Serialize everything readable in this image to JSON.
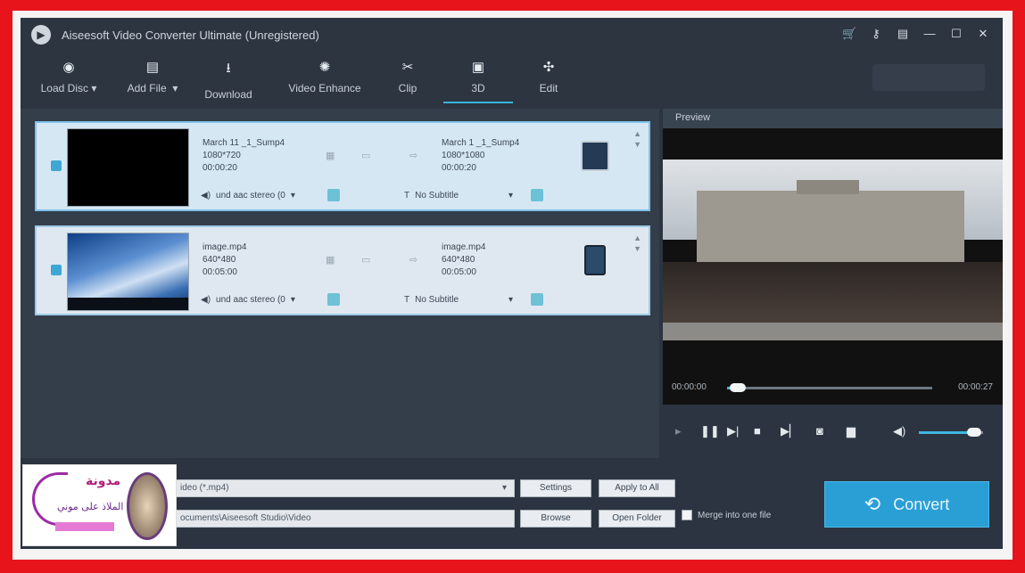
{
  "app": {
    "title": "Aiseesoft Video Converter Ultimate (Unregistered)"
  },
  "window_controls": [
    "cart-icon",
    "key-icon",
    "feedback-icon",
    "minimize-icon",
    "maximize-icon",
    "close-icon"
  ],
  "toolbar": {
    "items": [
      {
        "label": "Load Disc",
        "icon": "disc-icon"
      },
      {
        "label": "Add File",
        "icon": "add-file-icon"
      },
      {
        "label": "Download",
        "icon": "download-icon"
      },
      {
        "label": "Video Enhance",
        "icon": "enhance-icon"
      },
      {
        "label": "Clip",
        "icon": "scissors-icon"
      },
      {
        "label": "3D",
        "icon": "3d-icon"
      },
      {
        "label": "Edit",
        "icon": "edit-icon"
      }
    ]
  },
  "files": [
    {
      "source_name": "March 11 _1_Sump4",
      "source_res": "1080*720",
      "source_duration": "00:00:20",
      "target_name": "March 1 _1_Sump4",
      "target_res": "1080*1080",
      "target_duration": "00:00:20",
      "audio": "und aac stereo (0",
      "subtitle": "No Subtitle",
      "device_icon": "video-file-icon"
    },
    {
      "source_name": "image.mp4",
      "source_res": "640*480",
      "source_duration": "00:05:00",
      "target_name": "image.mp4",
      "target_res": "640*480",
      "target_duration": "00:05:00",
      "audio": "und aac stereo (0",
      "subtitle": "No Subtitle",
      "device_icon": "tablet-icon"
    }
  ],
  "preview": {
    "label": "Preview",
    "time_current": "00:00:00",
    "time_total": "00:00:27",
    "progress_fraction": 0.03,
    "volume_fraction": 0.8
  },
  "bottom": {
    "profile_value": "ideo (*.mp4)",
    "settings_label": "Settings",
    "apply_all_label": "Apply to All",
    "destination_value": "ocuments\\Aiseesoft Studio\\Video",
    "browse_label": "Browse",
    "open_folder_label": "Open Folder",
    "merge_label": "Merge into one file",
    "convert_label": "Convert"
  },
  "watermark": {
    "line1": "مدونة",
    "line2": "الملاذ على موني"
  },
  "colors": {
    "accent": "#2a9fd6",
    "background": "#2b3440"
  }
}
